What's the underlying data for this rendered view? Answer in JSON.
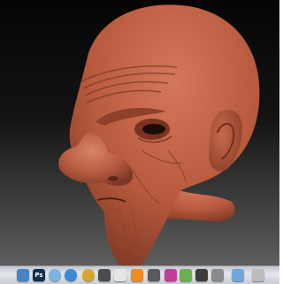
{
  "scene": {
    "background_colors": [
      "#050505",
      "#141414",
      "#5e5e5e"
    ],
    "model_color": "#b85a3e",
    "subject": "sculpted-old-man-head"
  },
  "dock": {
    "items": [
      {
        "name": "mail-icon",
        "label": "",
        "color": "#4a83c7"
      },
      {
        "name": "photoshop-icon",
        "label": "Ps",
        "color": "#0b2f56"
      },
      {
        "name": "itunes-icon",
        "label": "",
        "color": "#7fb3e0"
      },
      {
        "name": "safari-icon",
        "label": "",
        "color": "#3a8bd6"
      },
      {
        "name": "chrome-icon",
        "label": "",
        "color": "#d9a72c"
      },
      {
        "name": "photo-booth-icon",
        "label": "",
        "color": "#4c4c4c"
      },
      {
        "name": "preview-icon",
        "label": "",
        "color": "#e5e5e5"
      },
      {
        "name": "vlc-icon",
        "label": "",
        "color": "#f28a1c"
      },
      {
        "name": "zbrush-icon",
        "label": "",
        "color": "#5a5a5a"
      },
      {
        "name": "wifi-app-icon",
        "label": "",
        "color": "#c33a9a"
      },
      {
        "name": "messages-icon",
        "label": "",
        "color": "#6ab04c"
      },
      {
        "name": "terminal-icon",
        "label": "",
        "color": "#3d3d3d"
      },
      {
        "name": "app-icon",
        "label": "",
        "color": "#8a8a8a"
      },
      {
        "name": "folder-icon",
        "label": "",
        "color": "#6fa8dc"
      },
      {
        "name": "trash-icon",
        "label": "",
        "color": "#bcbcbc"
      }
    ]
  }
}
